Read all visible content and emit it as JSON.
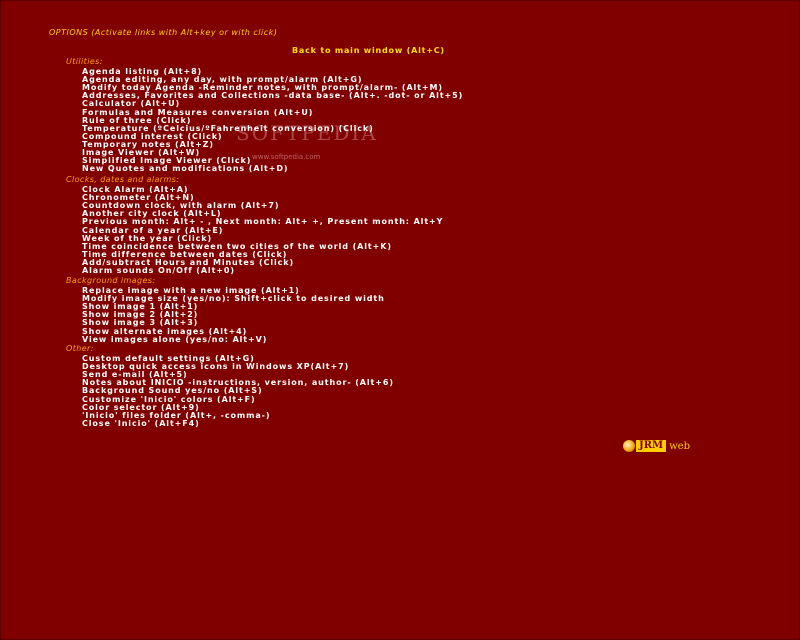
{
  "header": {
    "title": "OPTIONS (Activate links with Alt+key or with click)",
    "back_link": "Back to main window (Alt+C)"
  },
  "sections": [
    {
      "label": "Utilities:",
      "items": [
        "Agenda listing (Alt+8)",
        "Agenda editing, any day, with prompt/alarm (Alt+G)",
        "Modify today Agenda -Reminder notes, with prompt/alarm- (Alt+M)",
        "Addresses, Favorites and Collections -data base- (Alt+. -dot- or Alt+5)",
        "Calculator (Alt+U)",
        "Formulas and Measures conversion (Alt+U)",
        "Rule of three (Click)",
        "Temperature (ºCelcius/ºFahrenheit conversion) (Click)",
        "Compound interest (Click)",
        "Temporary notes (Alt+Z)",
        "Image Viewer (Alt+W)",
        "Simplified Image Viewer (Click)",
        "New Quotes and modifications (Alt+D)"
      ]
    },
    {
      "label": "Clocks, dates and alarms:",
      "items": [
        "Clock Alarm (Alt+A)",
        "Chronometer (Alt+N)",
        "Countdown clock, with alarm (Alt+7)",
        "Another city clock (Alt+L)",
        "Previous month: Alt+ - , Next month: Alt+ +, Present month: Alt+Y",
        "Calendar of a year (Alt+E)",
        "Week of the year (Click)",
        "Time coincidence between two cities of the world (Alt+K)",
        "Time difference between dates (Click)",
        "Add/subtract Hours and Minutes (Click)",
        "Alarm sounds On/Off (Alt+0)"
      ]
    },
    {
      "label": "Background images:",
      "items": [
        "Replace image with a new image (Alt+1)",
        "Modify image size (yes/no): Shift+click to desired width",
        "Show image 1 (Alt+1)",
        "Show image 2 (Alt+2)",
        "Show image 3 (Alt+3)",
        "Show alternate images (Alt+4)",
        "View images alone (yes/no: Alt+V)"
      ]
    },
    {
      "label": "Other:",
      "items": [
        "Custom default settings (Alt+G)",
        "Desktop quick access icons in Windows XP(Alt+7)",
        "Send e-mail (Alt+5)",
        "Notes about INICIO -instructions, version, author- (Alt+6)",
        "Background Sound yes/no (Alt+S)",
        "Customize 'Inicio' colors (Alt+F)",
        "Color selector (Alt+9)",
        "'Inicio' files folder (Alt+, -comma-)",
        "Close 'Inicio' (Alt+F4)"
      ]
    }
  ],
  "watermark": {
    "text": "SOFTPEDIA",
    "url": "www.softpedia.com"
  },
  "logo": {
    "text": "JRM",
    "suffix": "web",
    "icon": "jrm-logo-icon"
  },
  "colors": {
    "background": "#800000",
    "title": "#ffd000",
    "section": "#ffa000",
    "item": "#ffffff",
    "logo": "#ffcc00"
  }
}
